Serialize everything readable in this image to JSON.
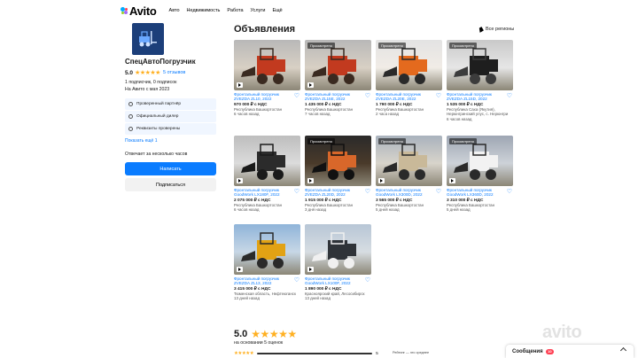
{
  "header": {
    "logo": "Avito",
    "nav": [
      "Авто",
      "Недвижимость",
      "Работа",
      "Услуги",
      "Ещё"
    ]
  },
  "seller": {
    "name": "СпецАвтоПогрузчик",
    "rating": "5.0",
    "reviews_link": "5 отзывов",
    "followers": "1 подписчик, 0 подписок",
    "since": "На Авито с мая 2023",
    "badges": [
      "Проверенный партнёр",
      "Официальный дилер",
      "Реквизиты проверены"
    ],
    "show_more": "Показать ещё 1",
    "answers": "Отвечает за несколько часов",
    "write_button": "Написать",
    "subscribe_button": "Подписаться"
  },
  "main": {
    "title": "Объявления",
    "regions": "Все регионы",
    "viewed_label": "Просмотрено"
  },
  "listings": [
    {
      "title": "Фронтальный погрузчик ZVEZDA ZL10, 2022",
      "price": "970 000 ₽ с НДС",
      "location": "Республика Башкортостан",
      "time": "6 часов назад",
      "viewed": false,
      "video": true,
      "image": "loader-red-orange"
    },
    {
      "title": "Фронтальный погрузчик ZVEZDA ZL15E, 2022",
      "price": "1 435 000 ₽ с НДС",
      "location": "Республика Башкортостан",
      "time": "7 часов назад",
      "viewed": true,
      "video": true,
      "image": "loader-red-orange"
    },
    {
      "title": "Фронтальный погрузчик ZVEZDA ZL20E, 2022",
      "price": "1 790 000 ₽ с НДС",
      "location": "Республика Башкортостан",
      "time": "2 часа назад",
      "viewed": true,
      "video": false,
      "image": "loader-orange-gift"
    },
    {
      "title": "Фронтальный погрузчик ZVEZDA ZL15D, 2022",
      "price": "1 535 000 ₽ с НДС",
      "location": "Республика Саха (Якутия), Нерюнгринский улус, с. Нерюнгри",
      "time": "6 часов назад",
      "viewed": true,
      "video": false,
      "image": "loader-black"
    },
    {
      "title": "Фронтальный погрузчик GoodWork LX180F, 2022",
      "price": "2 075 000 ₽ с НДС",
      "location": "Республика Башкортостан",
      "time": "6 часов назад",
      "viewed": false,
      "video": true,
      "image": "loader-dark"
    },
    {
      "title": "Фронтальный погрузчик ZVEZDA ZL20D, 2022",
      "price": "1 915 000 ₽ с НДС",
      "location": "Республика Башкортостан",
      "time": "3 дня назад",
      "viewed": true,
      "video": true,
      "image": "loader-gift-dark"
    },
    {
      "title": "Фронтальный погрузчик GoodWork LX300D, 2022",
      "price": "3 565 000 ₽ с НДС",
      "location": "Республика Башкортостан",
      "time": "5 дней назад",
      "viewed": true,
      "video": true,
      "image": "loader-beige"
    },
    {
      "title": "Фронтальный погрузчик GoodWork LX360D, 2022",
      "price": "3 310 000 ₽ с НДС",
      "location": "Республика Башкортостан",
      "time": "5 дней назад",
      "viewed": true,
      "video": true,
      "image": "loader-grey"
    },
    {
      "title": "Фронтальный погрузчик ZVEZDA ZL13, 2022",
      "price": "3 415 000 ₽ с НДС",
      "location": "Тюменская область, Нефтеюганск",
      "time": "13 дней назад",
      "viewed": false,
      "video": true,
      "image": "loader-yellow"
    },
    {
      "title": "Фронтальный погрузчик GoodWork LX100F, 2022",
      "price": "1 890 000 ₽ с НДС",
      "location": "Красноярский край, Лесосибирск",
      "time": "13 дней назад",
      "viewed": false,
      "video": true,
      "image": "loader-grey-dark"
    }
  ],
  "bottom": {
    "rating": "5.0",
    "based_on": "на основании 5 оценок",
    "bar_count": "5",
    "rating_note": "Рейтинг — это среднее"
  },
  "messages": {
    "label": "Сообщения",
    "badge": "10"
  },
  "watermark": "avito",
  "colors": {
    "accent": "#0a7cff",
    "star": "#ffb021",
    "badge_bg": "#f0f6ff",
    "notification": "#ff4053"
  }
}
